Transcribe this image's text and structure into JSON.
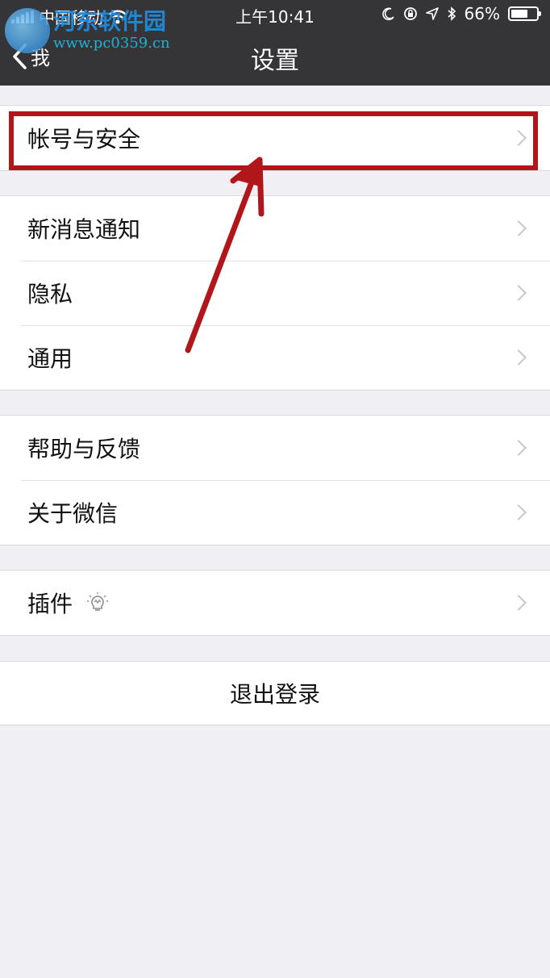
{
  "status_bar": {
    "carrier": "中国移动",
    "time": "上午10:41",
    "battery_percent": "66%",
    "battery_level": 0.66
  },
  "watermark": {
    "title": "河东软件园",
    "url": "www.pc0359.cn"
  },
  "nav": {
    "back_label": "我",
    "title": "设置"
  },
  "groups": [
    {
      "items": [
        "帐号与安全"
      ]
    },
    {
      "items": [
        "新消息通知",
        "隐私",
        "通用"
      ]
    },
    {
      "items": [
        "帮助与反馈",
        "关于微信"
      ]
    },
    {
      "items": [
        "插件"
      ]
    }
  ],
  "logout_label": "退出登录",
  "colors": {
    "nav_bg": "#353538",
    "page_bg": "#efeff4",
    "annotation": "#b0161a"
  },
  "icons": {
    "back": "chevron-left-icon",
    "plugin": "lightbulb-icon",
    "row": "chevron-right-icon"
  }
}
